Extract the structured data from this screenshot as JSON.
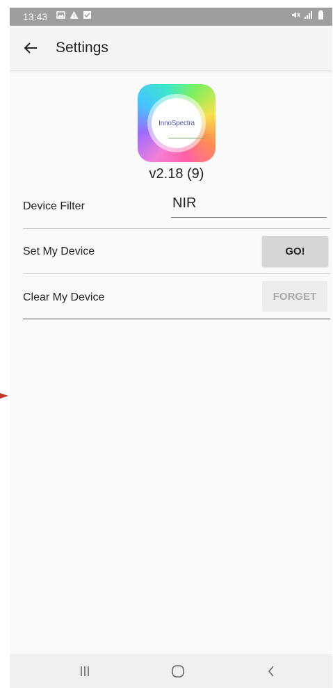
{
  "status_bar": {
    "time": "13:43",
    "left_icons": [
      "gallery-icon",
      "warning-icon",
      "check-box-icon"
    ],
    "right_icons": [
      "mute-icon",
      "signal-icon",
      "battery-icon"
    ]
  },
  "toolbar": {
    "title": "Settings"
  },
  "app": {
    "logo_text": "InnoSpectra",
    "version": "v2.18 (9)"
  },
  "settings": {
    "device_filter_label": "Device Filter",
    "device_filter_value": "NIR",
    "set_device_label": "Set My Device",
    "set_device_button": "GO!",
    "clear_device_label": "Clear My Device",
    "clear_device_button": "FORGET"
  },
  "nav_bar": {
    "items": [
      "recent-apps-icon",
      "home-icon",
      "back-icon"
    ]
  },
  "colors": {
    "status_bar": "#9e9e9e",
    "toolbar": "#f5f5f5",
    "background": "#fafafa",
    "button_enabled": "#d6d6d6",
    "button_disabled": "#ececec",
    "edge_arrow": "#c0392b"
  }
}
